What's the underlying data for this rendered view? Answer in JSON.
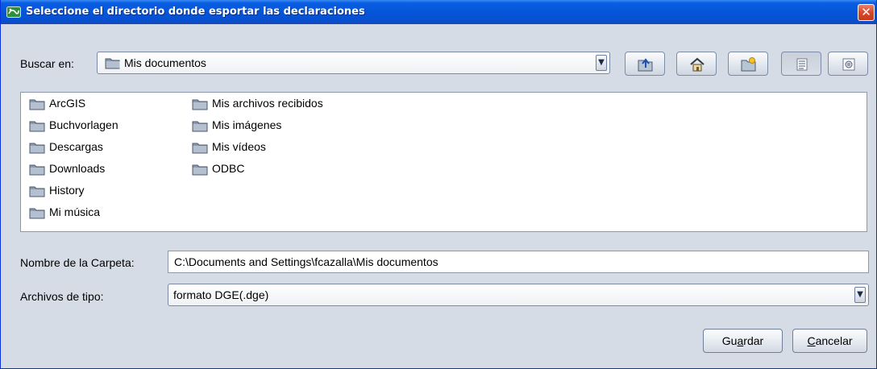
{
  "window": {
    "title": "Seleccione el directorio donde esportar las declaraciones",
    "close_glyph": "✕"
  },
  "lookin": {
    "label": "Buscar en:",
    "value": "Mis documentos"
  },
  "toolbar": [
    {
      "name": "up-folder-button",
      "icon": "up-folder-icon"
    },
    {
      "name": "home-button",
      "icon": "home-icon"
    },
    {
      "name": "new-folder-button",
      "icon": "new-folder-icon"
    },
    {
      "name": "list-view-button",
      "icon": "list-view-icon",
      "pressed": true
    },
    {
      "name": "details-view-button",
      "icon": "details-view-icon"
    }
  ],
  "files": {
    "column1": [
      "ArcGIS",
      "Buchvorlagen",
      "Descargas",
      "Downloads",
      "History",
      "Mi música"
    ],
    "column2": [
      "Mis archivos recibidos",
      "Mis imágenes",
      "Mis vídeos",
      "ODBC"
    ]
  },
  "folder_name": {
    "label": "Nombre de la Carpeta:",
    "value": "C:\\Documents and Settings\\fcazalla\\Mis documentos"
  },
  "file_type": {
    "label": "Archivos de tipo:",
    "value": "formato DGE(.dge)"
  },
  "buttons": {
    "save": {
      "pre": "Gu",
      "mnemonic": "a",
      "post": "rdar"
    },
    "cancel": {
      "pre": "",
      "mnemonic": "C",
      "post": "ancelar"
    }
  },
  "colors": {
    "titlebar": "#0555d8",
    "dialog_bg": "#d5dce6",
    "close": "#d8482b"
  }
}
